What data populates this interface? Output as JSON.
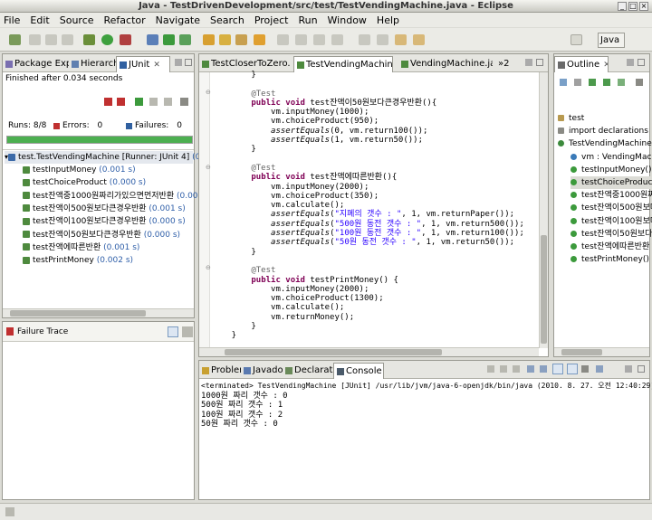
{
  "window": {
    "title": "Java - TestDrivenDevelopment/src/test/TestVendingMachine.java - Eclipse"
  },
  "menu": [
    "File",
    "Edit",
    "Source",
    "Refactor",
    "Navigate",
    "Search",
    "Project",
    "Run",
    "Window",
    "Help"
  ],
  "toolbar": {
    "perspective_label": "Java"
  },
  "left_panel": {
    "tabs": [
      "Package Explor",
      "Hierarchy",
      "JUnit"
    ],
    "status": "Finished after 0.034 seconds",
    "runs_label": "Runs:",
    "runs_value": "8/8",
    "errors_label": "Errors:",
    "errors_value": "0",
    "failures_label": "Failures:",
    "failures_value": "0",
    "progress_fraction": 1.0,
    "tree_root": {
      "name": "test.TestVendingMachine",
      "runner": "[Runner: JUnit 4]",
      "time": "(0.005 s"
    },
    "tests": [
      {
        "name": "testInputMoney",
        "time": "(0.001 s)"
      },
      {
        "name": "testChoiceProduct",
        "time": "(0.000 s)"
      },
      {
        "name": "test잔액중1000원짜리가있으면먼저반환",
        "time": "(0.000 s)"
      },
      {
        "name": "test잔액이500원보다큰경우반환",
        "time": "(0.001 s)"
      },
      {
        "name": "test잔액이100원보다큰경우반환",
        "time": "(0.000 s)"
      },
      {
        "name": "test잔액이50원보다큰경우반환",
        "time": "(0.000 s)"
      },
      {
        "name": "test잔액에따른반환",
        "time": "(0.001 s)"
      },
      {
        "name": "testPrintMoney",
        "time": "(0.002 s)"
      }
    ],
    "failure_trace_label": "Failure Trace"
  },
  "editor": {
    "tabs": [
      "TestCloserToZero.jav",
      "TestVendingMachine.j",
      "VendingMachine.java",
      "2"
    ],
    "active_tab": 1,
    "lines": [
      [
        {
          "t": "        }",
          "c": ""
        }
      ],
      [
        {
          "t": "",
          "c": ""
        }
      ],
      [
        {
          "t": "        @Test",
          "c": "ann"
        }
      ],
      [
        {
          "t": "        ",
          "c": ""
        },
        {
          "t": "public",
          "c": "kw"
        },
        {
          "t": " ",
          "c": ""
        },
        {
          "t": "void",
          "c": "kw"
        },
        {
          "t": " test잔액이50원보다큰경우반환(){",
          "c": ""
        }
      ],
      [
        {
          "t": "            vm.inputMoney(1000);",
          "c": ""
        }
      ],
      [
        {
          "t": "            vm.choiceProduct(950);",
          "c": ""
        }
      ],
      [
        {
          "t": "            ",
          "c": ""
        },
        {
          "t": "assertEquals",
          "c": "it"
        },
        {
          "t": "(0, vm.return100());",
          "c": ""
        }
      ],
      [
        {
          "t": "            ",
          "c": ""
        },
        {
          "t": "assertEquals",
          "c": "it"
        },
        {
          "t": "(1, vm.return50());",
          "c": ""
        }
      ],
      [
        {
          "t": "        }",
          "c": ""
        }
      ],
      [
        {
          "t": "",
          "c": ""
        }
      ],
      [
        {
          "t": "        @Test",
          "c": "ann"
        }
      ],
      [
        {
          "t": "        ",
          "c": ""
        },
        {
          "t": "public",
          "c": "kw"
        },
        {
          "t": " ",
          "c": ""
        },
        {
          "t": "void",
          "c": "kw"
        },
        {
          "t": " test잔액에따른반환(){",
          "c": ""
        }
      ],
      [
        {
          "t": "            vm.inputMoney(2000);",
          "c": ""
        }
      ],
      [
        {
          "t": "            vm.choiceProduct(350);",
          "c": ""
        }
      ],
      [
        {
          "t": "            vm.calculate();",
          "c": ""
        }
      ],
      [
        {
          "t": "            ",
          "c": ""
        },
        {
          "t": "assertEquals",
          "c": "it"
        },
        {
          "t": "(",
          "c": ""
        },
        {
          "t": "\"지폐의 갯수 : \"",
          "c": "str"
        },
        {
          "t": ", 1, vm.returnPaper());",
          "c": ""
        }
      ],
      [
        {
          "t": "            ",
          "c": ""
        },
        {
          "t": "assertEquals",
          "c": "it"
        },
        {
          "t": "(",
          "c": ""
        },
        {
          "t": "\"500원 동전 갯수 : \"",
          "c": "str"
        },
        {
          "t": ", 1, vm.return500());",
          "c": ""
        }
      ],
      [
        {
          "t": "            ",
          "c": ""
        },
        {
          "t": "assertEquals",
          "c": "it"
        },
        {
          "t": "(",
          "c": ""
        },
        {
          "t": "\"100원 동전 갯수 : \"",
          "c": "str"
        },
        {
          "t": ", 1, vm.return100());",
          "c": ""
        }
      ],
      [
        {
          "t": "            ",
          "c": ""
        },
        {
          "t": "assertEquals",
          "c": "it"
        },
        {
          "t": "(",
          "c": ""
        },
        {
          "t": "\"50원 동전 갯수 : \"",
          "c": "str"
        },
        {
          "t": ", 1, vm.return50());",
          "c": ""
        }
      ],
      [
        {
          "t": "        }",
          "c": ""
        }
      ],
      [
        {
          "t": "",
          "c": ""
        }
      ],
      [
        {
          "t": "        @Test",
          "c": "ann"
        }
      ],
      [
        {
          "t": "        ",
          "c": ""
        },
        {
          "t": "public",
          "c": "kw"
        },
        {
          "t": " ",
          "c": ""
        },
        {
          "t": "void",
          "c": "kw"
        },
        {
          "t": " testPrintMoney() {",
          "c": ""
        }
      ],
      [
        {
          "t": "            vm.inputMoney(2000);",
          "c": ""
        }
      ],
      [
        {
          "t": "            vm.choiceProduct(1300);",
          "c": ""
        }
      ],
      [
        {
          "t": "            vm.calculate();",
          "c": ""
        }
      ],
      [
        {
          "t": "            vm.returnMoney();",
          "c": ""
        }
      ],
      [
        {
          "t": "        }",
          "c": ""
        }
      ],
      [
        {
          "t": "    }",
          "c": ""
        }
      ]
    ]
  },
  "outline": {
    "tab": "Outline",
    "items": [
      {
        "label": "test",
        "kind": "package"
      },
      {
        "label": "import declarations",
        "kind": "imports"
      },
      {
        "label": "TestVendingMachine",
        "kind": "class"
      },
      {
        "label": "vm : VendingMachin",
        "kind": "field"
      },
      {
        "label": "testInputMoney()",
        "kind": "method"
      },
      {
        "label": "testChoiceProduct",
        "kind": "method"
      },
      {
        "label": "test잔액중1000원짜",
        "kind": "method"
      },
      {
        "label": "test잔액이500원보다",
        "kind": "method"
      },
      {
        "label": "test잔액이100원보다",
        "kind": "method"
      },
      {
        "label": "test잔액이50원보다",
        "kind": "method"
      },
      {
        "label": "test잔액에따른반환",
        "kind": "method"
      },
      {
        "label": "testPrintMoney()",
        "kind": "method"
      }
    ]
  },
  "console": {
    "tabs": [
      "Problems",
      "Javadoc",
      "Declaration",
      "Console"
    ],
    "active_tab": 3,
    "header": "<terminated> TestVendingMachine [JUnit] /usr/lib/jvm/java-6-openjdk/bin/java (2010. 8. 27. 오전 12:40:29)",
    "lines": [
      "1000원 짜리 갯수 : 0",
      "500원 짜리 갯수 : 1",
      "100원 짜리 갯수 : 2",
      "50원 짜리 갯수 : 0"
    ]
  },
  "colors": {
    "progress": "#4caf50",
    "keyword": "#7f0055",
    "string": "#2a00ff",
    "annotation": "#646464",
    "time": "#2e5ea8"
  }
}
